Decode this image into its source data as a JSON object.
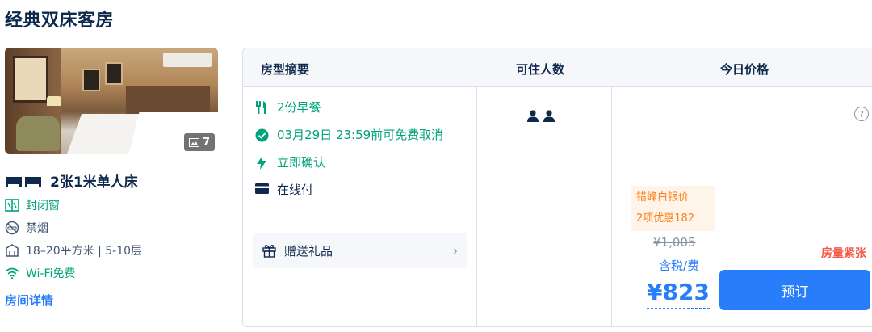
{
  "room": {
    "title": "经典双床客房",
    "photo_count": "7",
    "bed": "2张1米单人床",
    "features": [
      {
        "icon": "window-icon",
        "label": "封闭窗"
      },
      {
        "icon": "no-smoking-icon",
        "label": "禁烟"
      },
      {
        "icon": "area-icon",
        "label": "18–20平方米 | 5-10层"
      },
      {
        "icon": "wifi-icon",
        "label": "Wi-Fi免费"
      }
    ],
    "detail_link": "房间详情"
  },
  "table": {
    "headers": [
      "房型摘要",
      "可住人数",
      "今日价格"
    ]
  },
  "summary": {
    "breakfast": "2份早餐",
    "cancel": "03月29日 23:59前可免费取消",
    "confirm": "立即确认",
    "payment": "在线付",
    "gift": "赠送礼品"
  },
  "pricing": {
    "promo_line1": "错峰白银价",
    "promo_line2": "2项优惠182",
    "original": "¥1,005",
    "tax_note": "含税/费",
    "price": "¥823",
    "urgency": "房量紧张",
    "book_label": "预订"
  },
  "colors": {
    "accent": "#287dfa",
    "green": "#00a37a",
    "orange": "#ff7d13",
    "red": "#f5594a"
  }
}
